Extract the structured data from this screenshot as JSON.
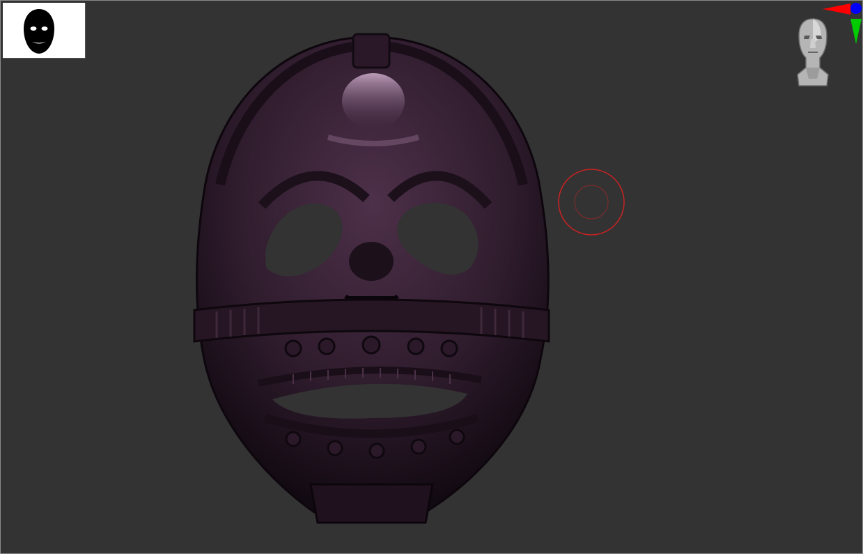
{
  "viewport": {
    "background": "#333333",
    "border": "#8a8a8a"
  },
  "model": {
    "icon": "mask-icon",
    "material_color": "#3b2438",
    "highlight_color": "#8a6a88"
  },
  "thumbnail": {
    "icon": "mask-silhouette-icon",
    "background": "#ffffff"
  },
  "brush_cursor": {
    "icon": "brush-circle-icon",
    "color": "#cc2222"
  },
  "navigator": {
    "icon": "head-navigator-icon"
  },
  "axis_gizmo": {
    "icon": "axis-gizmo-icon",
    "x_color": "#ff0000",
    "y_color": "#00cc00",
    "z_color": "#0000ff"
  }
}
